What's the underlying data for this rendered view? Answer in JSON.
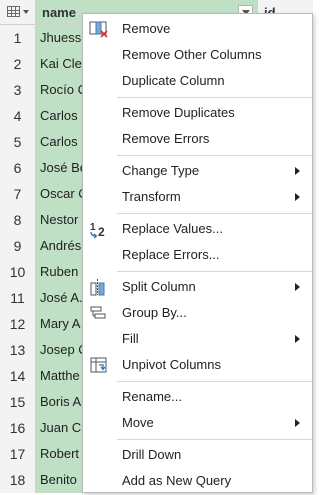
{
  "columns": {
    "name": "name",
    "id": "id"
  },
  "rows": [
    {
      "n": "1",
      "name": "Jhuess"
    },
    {
      "n": "2",
      "name": "Kai Cle"
    },
    {
      "n": "3",
      "name": "Rocío C"
    },
    {
      "n": "4",
      "name": "Carlos"
    },
    {
      "n": "5",
      "name": "Carlos"
    },
    {
      "n": "6",
      "name": "José Be"
    },
    {
      "n": "7",
      "name": "Oscar C"
    },
    {
      "n": "8",
      "name": "Nestor"
    },
    {
      "n": "9",
      "name": "Andrés"
    },
    {
      "n": "10",
      "name": "Ruben"
    },
    {
      "n": "11",
      "name": "José A."
    },
    {
      "n": "12",
      "name": "Mary A"
    },
    {
      "n": "13",
      "name": "Josep C"
    },
    {
      "n": "14",
      "name": "Matthe"
    },
    {
      "n": "15",
      "name": "Boris A"
    },
    {
      "n": "16",
      "name": "Juan Ca"
    },
    {
      "n": "17",
      "name": "Robert"
    },
    {
      "n": "18",
      "name": "Benito"
    }
  ],
  "menu": {
    "remove": "Remove",
    "remove_other_columns": "Remove Other Columns",
    "duplicate_column": "Duplicate Column",
    "remove_duplicates": "Remove Duplicates",
    "remove_errors": "Remove Errors",
    "change_type": "Change Type",
    "transform": "Transform",
    "replace_values": "Replace Values...",
    "replace_errors": "Replace Errors...",
    "split_column": "Split Column",
    "group_by": "Group By...",
    "fill": "Fill",
    "unpivot_columns": "Unpivot Columns",
    "rename": "Rename...",
    "move": "Move",
    "drill_down": "Drill Down",
    "add_as_new_query": "Add as New Query"
  }
}
